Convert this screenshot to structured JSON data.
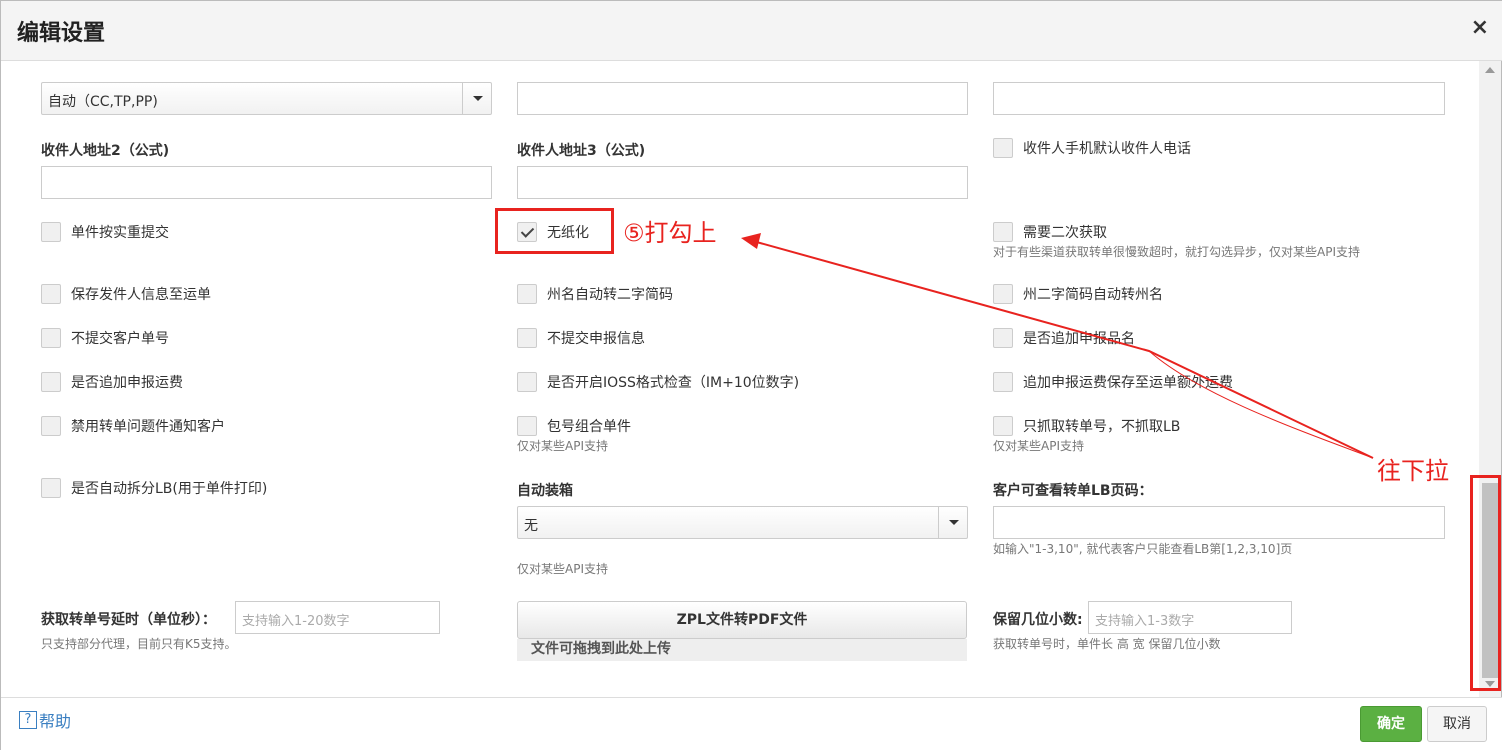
{
  "dialog": {
    "title": "编辑设置",
    "close_symbol": "×"
  },
  "row1": {
    "select_value": "自动（CC,TP,PP)"
  },
  "address": {
    "label2": "收件人地址2（公式)",
    "label3": "收件人地址3（公式)",
    "phone_default_label": "收件人手机默认收件人电话"
  },
  "checkboxes": {
    "weight_submit": "单件按实重提交",
    "paperless": "无纸化",
    "second_fetch": "需要二次获取",
    "second_fetch_note": "对于有些渠道获取转单很慢致超时，就打勾选异步，仅对某些API支持",
    "save_sender": "保存发件人信息至运单",
    "state_to_code": "州名自动转二字简码",
    "code_to_state": "州二字简码自动转州名",
    "no_customer_no": "不提交客户单号",
    "no_declare": "不提交申报信息",
    "append_product_name": "是否追加申报品名",
    "append_freight": "是否追加申报运费",
    "ioss_check": "是否开启IOSS格式检查（IM+10位数字)",
    "append_freight_extra": "追加申报运费保存至运单额外运费",
    "disable_notify": "禁用转单问题件通知客户",
    "pack_combine": "包号组合单件",
    "pack_combine_note": "仅对某些API支持",
    "only_tracking": "只抓取转单号，不抓取LB",
    "only_tracking_note": "仅对某些API支持",
    "auto_split_lb": "是否自动拆分LB(用于单件打印)"
  },
  "auto_box": {
    "label": "自动装箱",
    "value": "无",
    "note": "仅对某些API支持"
  },
  "lb_pages": {
    "label": "客户可查看转单LB页码：",
    "note": "如输入\"1-3,10\", 就代表客户只能查看LB第[1,2,3,10]页"
  },
  "delay": {
    "label": "获取转单号延时（单位秒）：",
    "placeholder": "支持输入1-20数字",
    "note": "只支持部分代理，目前只有K5支持。"
  },
  "zpl": {
    "button": "ZPL文件转PDF文件",
    "drop": "文件可拖拽到此处上传"
  },
  "decimals": {
    "label": "保留几位小数:",
    "placeholder": "支持输入1-3数字",
    "note": "获取转单号时，单件长 高 宽 保留几位小数"
  },
  "footer": {
    "help": "帮助",
    "help_icon": "?",
    "ok": "确定",
    "cancel": "取消"
  },
  "annotations": {
    "step5": "⑤打勾上",
    "scroll_down": "往下拉",
    "color": "#e8231f"
  }
}
